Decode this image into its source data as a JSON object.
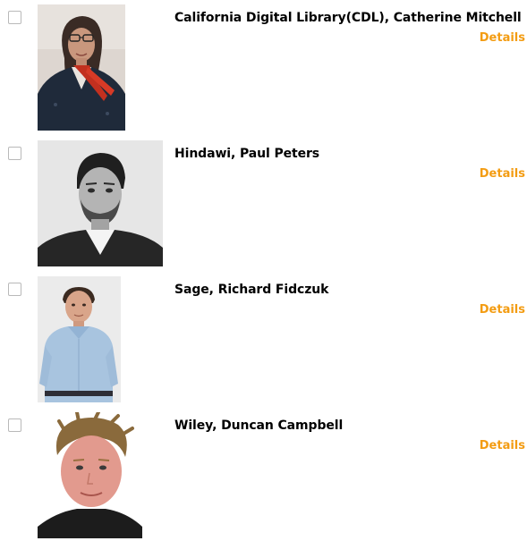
{
  "entries": [
    {
      "title": "California Digital Library(CDL), Catherine Mitchell",
      "details_label": "Details",
      "checked": false
    },
    {
      "title": "Hindawi, Paul Peters",
      "details_label": "Details",
      "checked": false
    },
    {
      "title": "Sage, Richard Fidczuk",
      "details_label": "Details",
      "checked": false
    },
    {
      "title": "Wiley, Duncan Campbell",
      "details_label": "Details",
      "checked": false
    }
  ],
  "colors": {
    "details_link": "#f39c12",
    "title_text": "#000000",
    "checkbox_border": "#b9b9b9"
  }
}
